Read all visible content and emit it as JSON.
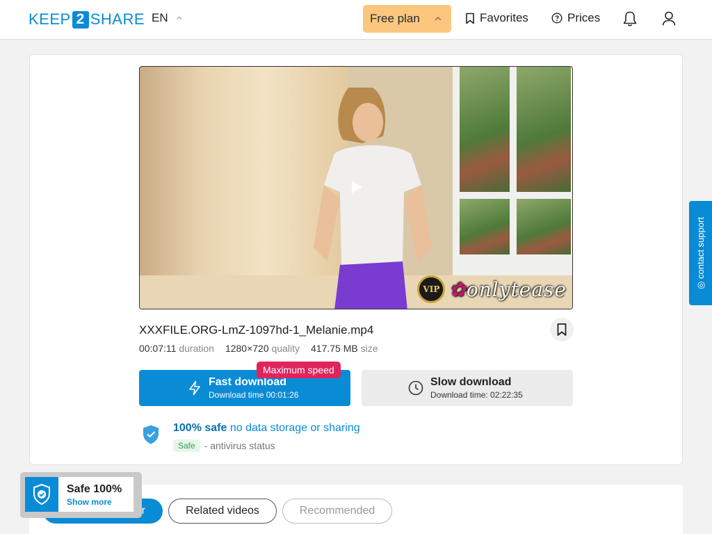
{
  "header": {
    "logo": {
      "left": "KEEP",
      "middle": "2",
      "right": "SHARE"
    },
    "language": "EN",
    "plan_button": "Free plan",
    "favorites": "Favorites",
    "prices": "Prices",
    "icons": [
      "chevron-up-icon",
      "bookmark-icon",
      "help-circle-icon",
      "bell-icon",
      "user-icon"
    ]
  },
  "video": {
    "watermark_badge": "VIP",
    "watermark_text": "onlytease"
  },
  "file": {
    "name": "XXXFILE.ORG-LmZ-1097hd-1_Melanie.mp4",
    "duration_value": "00:07:11",
    "duration_label": "duration",
    "quality_value": "1280×720",
    "quality_label": "quality",
    "size_value": "417.75 MB",
    "size_label": "size"
  },
  "download": {
    "fast_title": "Fast download",
    "fast_sub": "Download time 00:01:26",
    "badge": "Maximum speed",
    "slow_title": "Slow download",
    "slow_sub": "Download time: 02:22:35"
  },
  "safety": {
    "bold": "100% safe",
    "rest": "no data storage or sharing",
    "status_badge": "Safe",
    "status_text": "- antivirus status"
  },
  "support_tab": "◎ contact support",
  "tabs": [
    "From this partner",
    "Related videos",
    "Recommended"
  ],
  "safe_widget": {
    "title": "Safe 100%",
    "link": "Show more"
  },
  "colors": {
    "accent": "#0a8bd6",
    "plan": "#fbc77f",
    "badge": "#e0245e"
  }
}
